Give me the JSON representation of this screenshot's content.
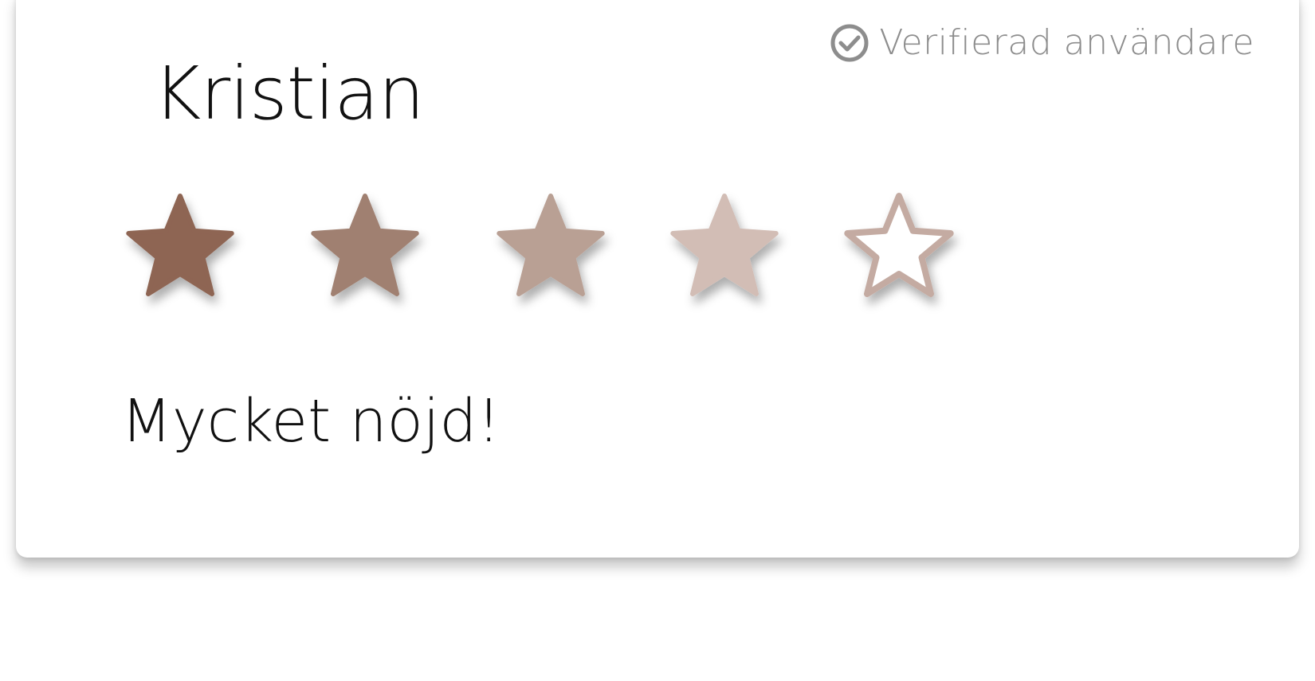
{
  "review": {
    "reviewer_name": "Kristian",
    "verified_label": "Verifierad användare",
    "review_text": "Mycket nöjd!",
    "rating": {
      "value": 4,
      "max": 5,
      "star_colors": [
        "#8e6553",
        "#a08071",
        "#b9a094",
        "#d2bdb5",
        "#c4aba2"
      ]
    }
  },
  "colors": {
    "verified": "#8d8d8d",
    "text": "#111111",
    "card_background": "#ffffff"
  },
  "icons": {
    "verified": "check-circle-icon",
    "rating": "star-icon"
  }
}
